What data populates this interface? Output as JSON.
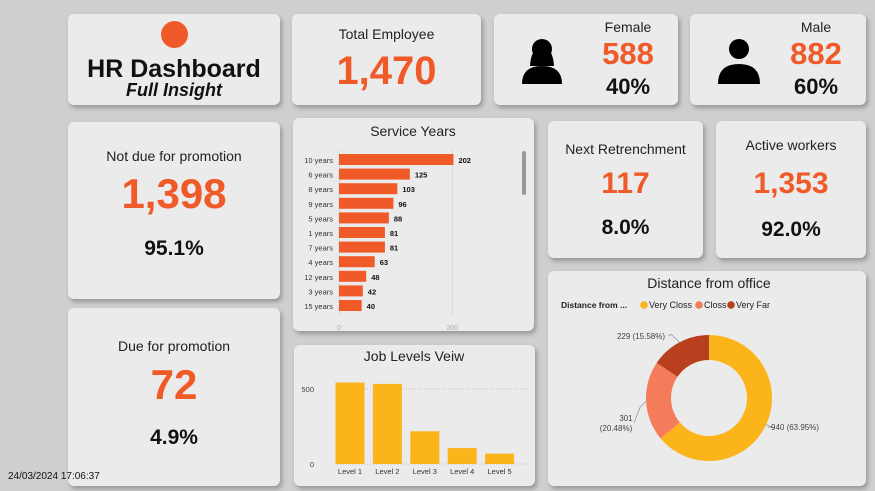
{
  "header": {
    "title": "HR Dashboard",
    "subtitle": "Full Insight",
    "logo_color": "#f05a28"
  },
  "total_employee": {
    "label": "Total Employee",
    "value": "1,470"
  },
  "female": {
    "label": "Female",
    "value": "588",
    "percent": "40%"
  },
  "male": {
    "label": "Male",
    "value": "882",
    "percent": "60%"
  },
  "not_due": {
    "label": "Not due for promotion",
    "value": "1,398",
    "percent": "95.1%"
  },
  "due": {
    "label": "Due for promotion",
    "value": "72",
    "percent": "4.9%"
  },
  "retrenchment": {
    "label": "Next Retrenchment",
    "value": "117",
    "percent": "8.0%"
  },
  "active": {
    "label": "Active workers",
    "value": "1,353",
    "percent": "92.0%"
  },
  "timestamp": "24/03/2024 17:06:37",
  "colors": {
    "accent": "#f05a28",
    "bar_yellow": "#fbb41a",
    "card": "#ebebeb",
    "background": "#cfcfcf"
  },
  "chart_data": [
    {
      "type": "bar",
      "orientation": "horizontal",
      "title": "Service Years",
      "categories": [
        "10 years",
        "6 years",
        "8 years",
        "9 years",
        "5 years",
        "1 years",
        "7 years",
        "4 years",
        "12 years",
        "3 years",
        "15 years"
      ],
      "values": [
        202,
        125,
        103,
        96,
        88,
        81,
        81,
        63,
        48,
        42,
        40
      ],
      "xticks": [
        "0",
        "200"
      ],
      "xlim": [
        0,
        210
      ],
      "color": "#f05a28"
    },
    {
      "type": "bar",
      "title": "Job Levels Veiw",
      "categories": [
        "Level 1",
        "Level 2",
        "Level 3",
        "Level 4",
        "Level 5"
      ],
      "values": [
        543,
        534,
        218,
        106,
        69
      ],
      "yticks": [
        "500",
        "0"
      ],
      "ylim": [
        0,
        600
      ],
      "color": "#fbb41a"
    },
    {
      "type": "pie",
      "donut": true,
      "title": "Distance from office",
      "legend_title": "Distance from ...",
      "legend_position": "top-left",
      "slices": [
        {
          "name": "Very Closs",
          "value": 940,
          "label": "940 (63.95%)",
          "color": "#fbb41a"
        },
        {
          "name": "Closs",
          "value": 301,
          "label_line1": "301",
          "label_line2": "(20.48%)",
          "color": "#f47c5a"
        },
        {
          "name": "Very Far",
          "value": 229,
          "label": "229 (15.58%)",
          "color": "#b8401e"
        }
      ]
    }
  ]
}
